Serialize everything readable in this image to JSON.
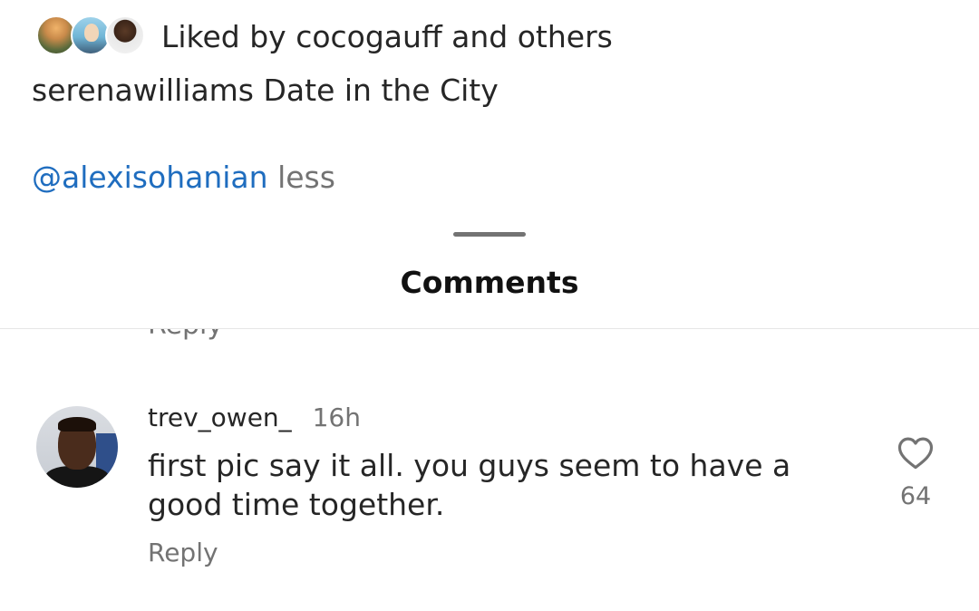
{
  "likes": {
    "text": "Liked by cocogauff and others"
  },
  "caption": {
    "username": "serenawilliams",
    "text": "Date in the City",
    "mention": "@alexisohanian",
    "less_label": "less"
  },
  "sheet": {
    "title": "Comments"
  },
  "previous_comment": {
    "reply_label": "Reply"
  },
  "comment": {
    "username": "trev_owen_",
    "time": "16h",
    "text": "first pic say it all. you guys seem to have a good time together.",
    "reply_label": "Reply",
    "like_count": "64"
  },
  "icons": {
    "like": "heart-outline-icon"
  }
}
